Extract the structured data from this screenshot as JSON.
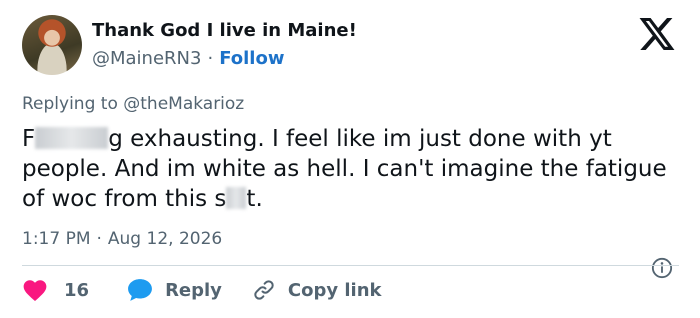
{
  "author": {
    "display_name": "Thank God I live in Maine!",
    "handle": "@MaineRN3",
    "separator": "·",
    "follow_label": "Follow"
  },
  "brand": {
    "icon": "x-logo-icon",
    "color": "#0f1419"
  },
  "reply_context": {
    "prefix": "Replying to",
    "mention": "@theMakarioz"
  },
  "tweet": {
    "text_part1": "F",
    "text_part2": "g exhausting. I feel like im just done with yt people. And im white as hell. I can't imagine the fatigue of woc from this s",
    "text_part3": "t."
  },
  "meta": {
    "time": "1:17 PM",
    "separator": "·",
    "date": "Aug 12, 2026"
  },
  "actions": {
    "like_count": "16",
    "reply_label": "Reply",
    "copy_link_label": "Copy link"
  },
  "colors": {
    "accent": "#1d72c9",
    "like": "#f91880",
    "reply": "#1d9bf0",
    "muted": "#536471"
  }
}
